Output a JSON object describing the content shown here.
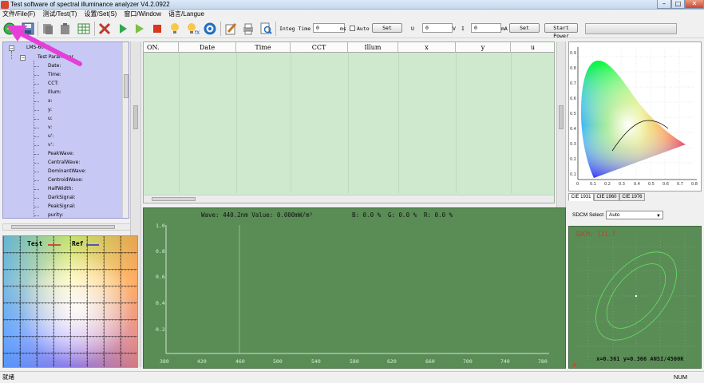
{
  "window": {
    "title": "Test software of spectral illuminance analyzer V4.2.0922",
    "min_label": "–",
    "max_label": "□",
    "close_label": "✕"
  },
  "menu": [
    "文件/File(F)",
    "测试/Test(T)",
    "设置/Set(S)",
    "窗口/Window",
    "语言/Langue"
  ],
  "toolbar": {
    "integ_label": "Integ Time",
    "integ_value": "0",
    "integ_unit": "ms",
    "auto_label": "Auto",
    "set_label": "Set",
    "u_label": "U",
    "u_value": "0",
    "v_unit": "V",
    "i_label": "I",
    "i_value": "0",
    "ma_unit": "mA",
    "set2_label": "Set",
    "start_power_label": "Start Power"
  },
  "tree": {
    "root": "LMS-6000",
    "group": "Test Parameter",
    "items": [
      "Date:",
      "Time:",
      "CCT:",
      "Illum:",
      "x:",
      "y:",
      "u:",
      "v:",
      "u':",
      "v':",
      "PeakWave:",
      "CentralWave:",
      "DominantWave:",
      "CentroidWave:",
      "HalfWidth:",
      "DarkSignal:",
      "PeakSignal:",
      "purity:"
    ]
  },
  "legend": {
    "test": "Test",
    "ref": "Ref",
    "test_color": "#d42020",
    "ref_color": "#2030c0"
  },
  "table": {
    "columns": [
      "ON.",
      "Date",
      "Time",
      "CCT",
      "Illum",
      "x",
      "y",
      "u"
    ],
    "rows": []
  },
  "spectrum": {
    "wave": "Wave: 440.2nm Value: 0.000mW/m²",
    "b": "B: 0.0 %",
    "g": "G: 0.0 %",
    "r": "R: 0.0 %",
    "yticks": [
      "1.0",
      "0.8",
      "0.6",
      "0.4",
      "0.2"
    ],
    "xticks": [
      "380",
      "420",
      "460",
      "500",
      "540",
      "580",
      "620",
      "660",
      "700",
      "740",
      "780"
    ]
  },
  "cie": {
    "tabs": [
      "CIE 1931",
      "CIE 1960",
      "CIE 1976"
    ],
    "xticks": [
      "0",
      "0.1",
      "0.2",
      "0.3",
      "0.4",
      "0.5",
      "0.6",
      "0.7",
      "0.8"
    ],
    "yticks": [
      "0.9",
      "0.8",
      "0.7",
      "0.6",
      "0.5",
      "0.4",
      "0.3",
      "0.2",
      "0.1"
    ]
  },
  "sdcm": {
    "select_label": "SDCM Select",
    "select_value": "Auto",
    "value": "SDCM: 171.7",
    "coords": "x=0.361 y=0.366 ANSI/4500K"
  },
  "statusbar": {
    "left": "就绪",
    "right": "NUM"
  },
  "colors": {
    "tree_bg": "#c7c8f3",
    "table_bg": "#cfe9cf",
    "plot_bg": "#5a8d56",
    "annotation_arrow": "#e63fd8"
  }
}
